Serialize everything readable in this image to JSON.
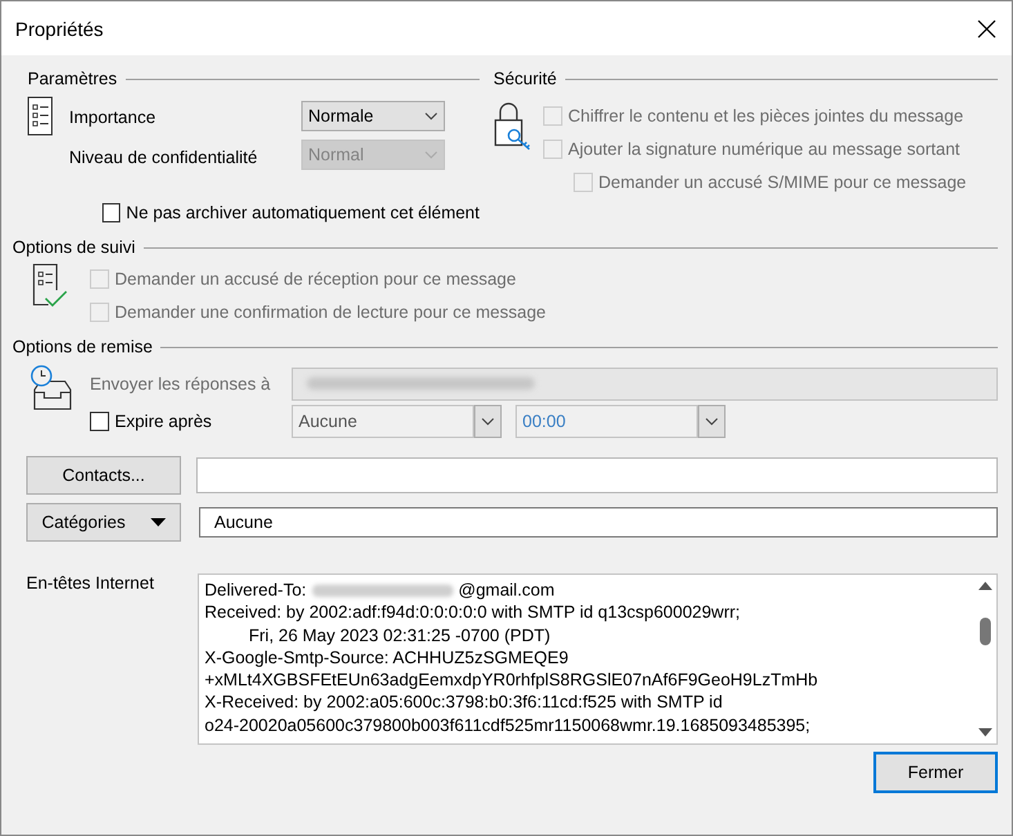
{
  "window": {
    "title": "Propriétés"
  },
  "parametres": {
    "title": "Paramètres",
    "importance": {
      "label": "Importance",
      "value": "Normale",
      "disabled": false
    },
    "confidentialite": {
      "label": "Niveau de confidentialité",
      "value": "Normal",
      "disabled": true
    },
    "archive": {
      "label": "Ne pas archiver automatiquement cet élément",
      "checked": false,
      "disabled": false
    }
  },
  "securite": {
    "title": "Sécurité",
    "options": [
      {
        "kind": "option",
        "label": "Chiffrer le contenu et les pièces jointes du message",
        "checked": false,
        "disabled": true
      },
      {
        "kind": "option",
        "label": "Ajouter la signature numérique au message sortant",
        "checked": false,
        "disabled": true
      },
      {
        "kind": "suboption",
        "label": "Demander un accusé S/MIME pour ce message",
        "checked": false,
        "disabled": true
      }
    ]
  },
  "suivi": {
    "title": "Options de suivi",
    "options": [
      {
        "label": "Demander un accusé de réception pour ce message",
        "checked": false,
        "disabled": true
      },
      {
        "label": "Demander une confirmation de lecture pour ce message",
        "checked": false,
        "disabled": true
      }
    ]
  },
  "remise": {
    "title": "Options de remise",
    "reply_to": {
      "label": "Envoyer les réponses à",
      "disabled": true
    },
    "expire": {
      "label": "Expire après",
      "checked": false,
      "date": "Aucune",
      "time": "00:00"
    }
  },
  "contacts": {
    "button": "Contacts..."
  },
  "categories": {
    "button": "Catégories",
    "value": "Aucune"
  },
  "headers": {
    "label": "En-têtes Internet",
    "lines": [
      {
        "kind": "redacted",
        "before": "Delivered-To:",
        "after": "@gmail.com"
      },
      {
        "kind": "text",
        "text": "Received: by 2002:adf:f94d:0:0:0:0:0 with SMTP id q13csp600029wrr;"
      },
      {
        "kind": "indent",
        "text": "Fri, 26 May 2023 02:31:25 -0700 (PDT)"
      },
      {
        "kind": "text",
        "text": "X-Google-Smtp-Source: ACHHUZ5zSGMEQE9"
      },
      {
        "kind": "text",
        "text": "+xMLt4XGBSFEtEUn63adgEemxdpYR0rhfplS8RGSlE07nAf6F9GeoH9LzTmHb"
      },
      {
        "kind": "text",
        "text": "X-Received: by 2002:a05:600c:3798:b0:3f6:11cd:f525 with SMTP id"
      },
      {
        "kind": "text",
        "text": "o24-20020a05600c379800b003f611cdf525mr1150068wmr.19.1685093485395;"
      }
    ]
  },
  "close_button": "Fermer"
}
